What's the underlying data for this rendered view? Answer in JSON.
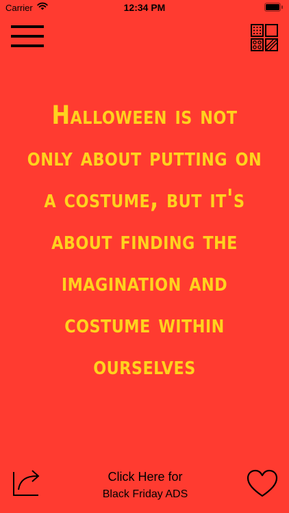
{
  "status_bar": {
    "carrier": "Carrier",
    "time": "12:34 PM",
    "wifi_icon": "wifi-icon",
    "battery_icon": "battery-icon"
  },
  "toolbar": {
    "menu_icon": "hamburger-menu-icon",
    "categories_icon": "pattern-grid-icon"
  },
  "quote": {
    "text": "Halloween is not only about putting on a costume, but it's about finding the imagination and costume within ourselves"
  },
  "bottom_bar": {
    "share_icon": "share-icon",
    "ads_line1": "Click Here for",
    "ads_line2": "Black Friday ADS",
    "favorite_icon": "heart-icon"
  },
  "colors": {
    "background": "#FF3B30",
    "quote_text": "#FFD21E",
    "icons": "#000000"
  }
}
